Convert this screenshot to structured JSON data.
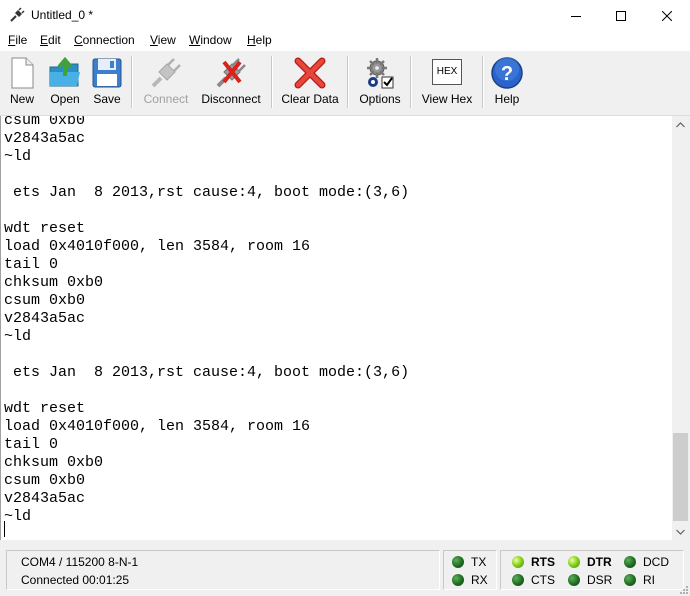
{
  "window": {
    "title": "Untitled_0 *"
  },
  "menu": {
    "items": [
      {
        "key": "F",
        "rest": "ile"
      },
      {
        "key": "E",
        "rest": "dit"
      },
      {
        "key": "C",
        "rest": "onnection"
      },
      {
        "key": "V",
        "rest": "iew"
      },
      {
        "key": "W",
        "rest": "indow"
      },
      {
        "key": "H",
        "rest": "elp"
      }
    ]
  },
  "toolbar": {
    "new": "New",
    "open": "Open",
    "save": "Save",
    "connect": "Connect",
    "disconnect": "Disconnect",
    "clear": "Clear Data",
    "options": "Options",
    "hex_icon_text": "HEX",
    "viewhex": "View Hex",
    "help": "Help"
  },
  "terminal": {
    "lines": [
      "csum 0xb0",
      "v2843a5ac",
      "~ld",
      "",
      " ets Jan  8 2013,rst cause:4, boot mode:(3,6)",
      "",
      "wdt reset",
      "load 0x4010f000, len 3584, room 16",
      "tail 0",
      "chksum 0xb0",
      "csum 0xb0",
      "v2843a5ac",
      "~ld",
      "",
      " ets Jan  8 2013,rst cause:4, boot mode:(3,6)",
      "",
      "wdt reset",
      "load 0x4010f000, len 3584, room 16",
      "tail 0",
      "chksum 0xb0",
      "csum 0xb0",
      "v2843a5ac",
      "~ld"
    ]
  },
  "status": {
    "port": "COM4 / 115200 8-N-1",
    "connected": "Connected 00:01:25",
    "signals": {
      "tx": {
        "label": "TX",
        "state": "off"
      },
      "rx": {
        "label": "RX",
        "state": "off"
      },
      "rts": {
        "label": "RTS",
        "state": "on"
      },
      "cts": {
        "label": "CTS",
        "state": "off"
      },
      "dtr": {
        "label": "DTR",
        "state": "on"
      },
      "dsr": {
        "label": "DSR",
        "state": "off"
      },
      "dcd": {
        "label": "DCD",
        "state": "off"
      },
      "ri": {
        "label": "RI",
        "state": "off"
      }
    }
  },
  "colors": {
    "led_on": "#8bd31a",
    "led_off": "#1f6b1f",
    "help_blue": "#2a63c9",
    "clear_red": "#d8231c"
  }
}
